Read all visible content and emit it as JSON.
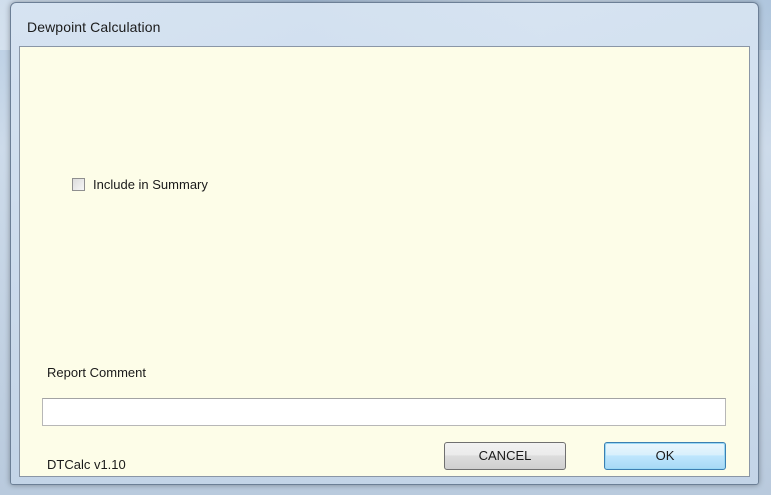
{
  "window": {
    "title": "Dewpoint Calculation"
  },
  "options": {
    "include_in_summary_label": "Include in Summary",
    "include_in_summary_checked": false
  },
  "report": {
    "label": "Report Comment",
    "value": ""
  },
  "footer": {
    "version": "DTCalc v1.10",
    "cancel_label": "CANCEL",
    "ok_label": "OK"
  },
  "colors": {
    "client_background": "#fdfde8",
    "window_frame": "#c4d5e8",
    "ok_button_accent": "#3c7fb1"
  }
}
